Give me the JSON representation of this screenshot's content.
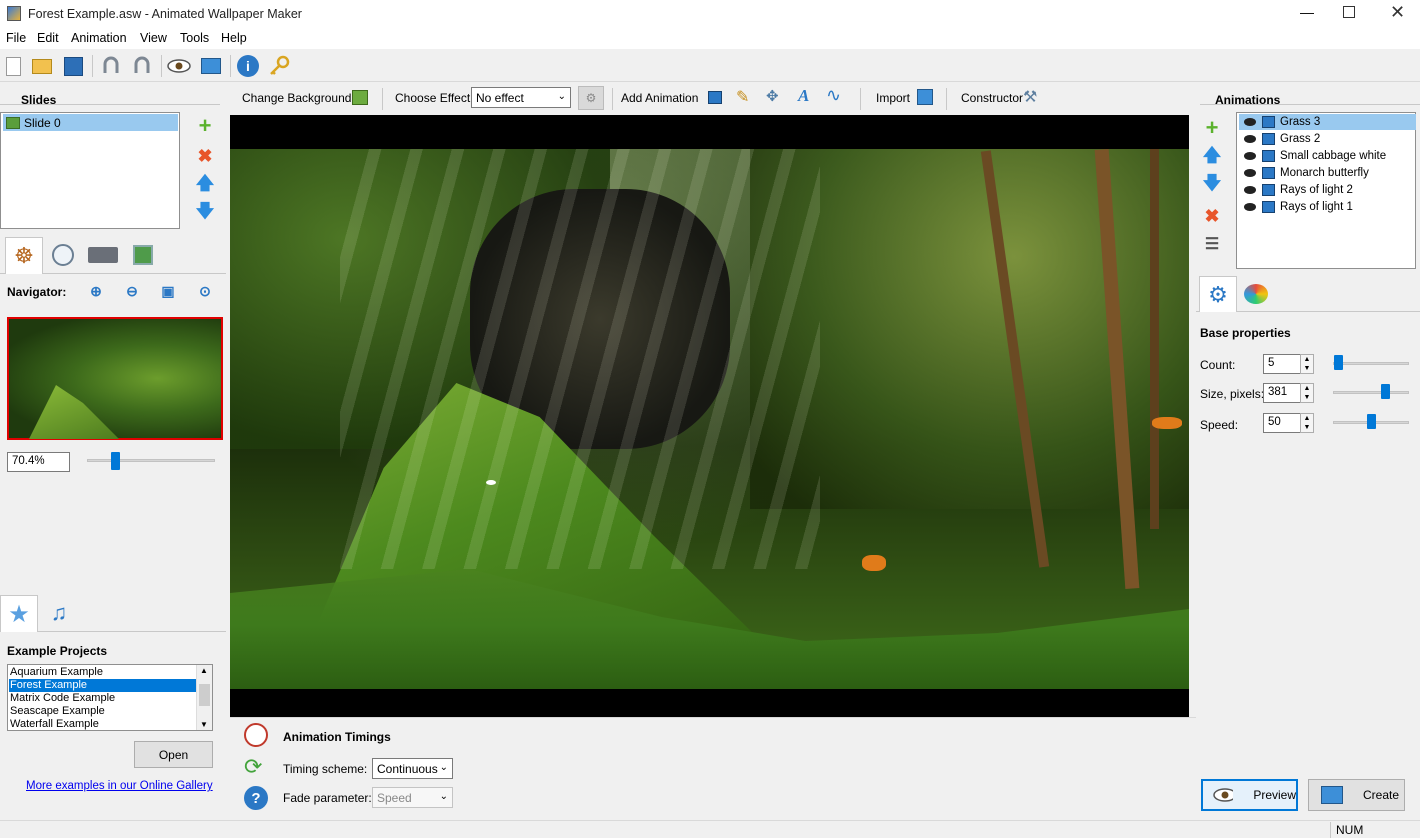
{
  "window": {
    "title": "Forest Example.asw - Animated Wallpaper Maker"
  },
  "menu": [
    "File",
    "Edit",
    "Animation",
    "View",
    "Tools",
    "Help"
  ],
  "toolbar2": {
    "change_background": "Change Background",
    "choose_effect": "Choose Effect:",
    "effect_value": "No effect",
    "add_animation": "Add Animation",
    "import": "Import",
    "constructor": "Constructor"
  },
  "slides": {
    "title": "Slides",
    "items": [
      "Slide 0"
    ]
  },
  "navigator": {
    "label": "Navigator:",
    "zoom": "70.4%",
    "zoom_fraction": 0.2
  },
  "examples": {
    "title": "Example Projects",
    "items": [
      "Aquarium Example",
      "Forest Example",
      "Matrix Code Example",
      "Seascape Example",
      "Waterfall Example"
    ],
    "selected": "Forest Example",
    "open": "Open",
    "gallery_link": "More examples in our Online Gallery"
  },
  "timings": {
    "title": "Animation Timings",
    "scheme_label": "Timing scheme:",
    "scheme_value": "Continuous",
    "fade_label": "Fade parameter:",
    "fade_value": "Speed"
  },
  "animations": {
    "title": "Animations",
    "items": [
      "Grass 3",
      "Grass 2",
      "Small cabbage white",
      "Monarch butterfly",
      "Rays of light 2",
      "Rays of light 1"
    ],
    "selected": "Grass 3"
  },
  "properties": {
    "title": "Base properties",
    "count_label": "Count:",
    "count": "5",
    "count_fraction": 0.02,
    "size_label": "Size, pixels:",
    "size": "381",
    "size_fraction": 0.72,
    "speed_label": "Speed:",
    "speed": "50",
    "speed_fraction": 0.5
  },
  "actions": {
    "preview": "Preview",
    "create": "Create"
  },
  "status": {
    "num": "NUM"
  },
  "colors": {
    "accent": "#0078d7",
    "selection": "#99c9ef",
    "nav_border": "#e00000"
  }
}
